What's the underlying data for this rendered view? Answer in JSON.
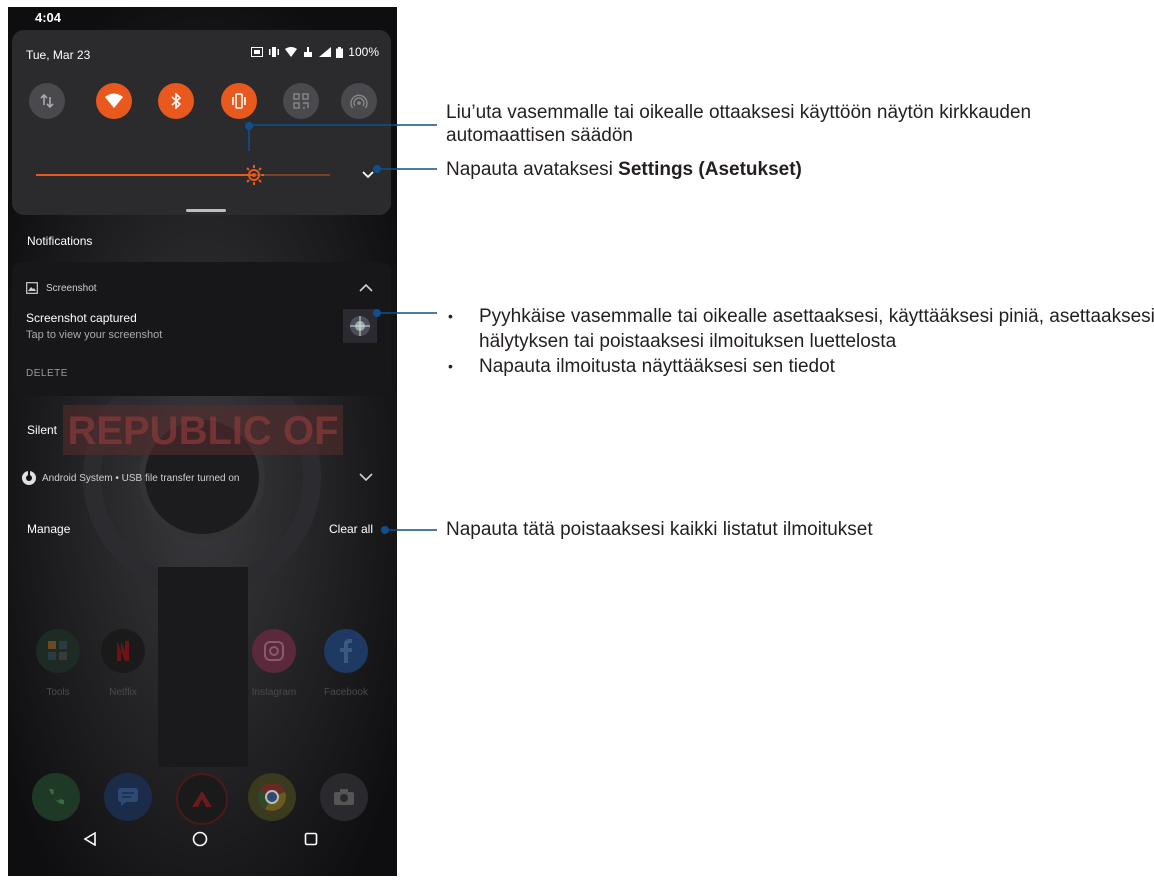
{
  "status_bar": {
    "time": "4:04"
  },
  "quick_settings": {
    "date": "Tue, Mar 23",
    "battery": "100%",
    "tiles": [
      {
        "icon": "mobile-data-icon",
        "state": "off"
      },
      {
        "icon": "wifi-icon",
        "state": "on"
      },
      {
        "icon": "bluetooth-icon",
        "state": "on"
      },
      {
        "icon": "vibrate-icon",
        "state": "on"
      },
      {
        "icon": "qr-scan-icon",
        "state": "off"
      },
      {
        "icon": "hotspot-icon",
        "state": "off"
      }
    ],
    "brightness_level": 0.74
  },
  "notifications": {
    "header": "Notifications",
    "items": [
      {
        "app": "Screenshot",
        "title": "Screenshot captured",
        "text": "Tap to view your screenshot",
        "action": "DELETE"
      }
    ],
    "silent_header": "Silent",
    "silent_items": [
      {
        "app": "Android System",
        "text": "USB file transfer turned on",
        "line": "Android System • USB file transfer turned on"
      }
    ],
    "manage_label": "Manage",
    "clear_all_label": "Clear all"
  },
  "home_screen": {
    "wallpaper_text": "REPUBLIC OF",
    "apps": [
      {
        "label": "Tools"
      },
      {
        "label": "Netflix"
      },
      {
        "label": "Instagram"
      },
      {
        "label": "Facebook"
      }
    ],
    "dock": [
      "phone-icon",
      "messages-icon",
      "armoury-icon",
      "chrome-icon",
      "camera-icon"
    ]
  },
  "callouts": {
    "brightness": "Liu’uta vasemmalle tai oikealle ottaaksesi käyttöön näytön kirkkauden automaattisen säädön",
    "settings_prefix": "Napauta avataksesi ",
    "settings_bold": "Settings (Asetukset)",
    "notification_bullets": [
      "Pyyhkäise vasemmalle tai oikealle asettaaksesi, käyttääksesi piniä, asettaaksesi hälytyksen tai poistaaksesi ilmoituksen luettelosta",
      "Napauta ilmoitusta näyttääksesi sen tiedot"
    ],
    "clear_all": "Napauta tätä poistaaksesi kaikki listatut ilmoitukset"
  },
  "colors": {
    "accent": "#e9591e",
    "callout_line": "#0f4f8c",
    "panel": "#2b2b2e"
  }
}
